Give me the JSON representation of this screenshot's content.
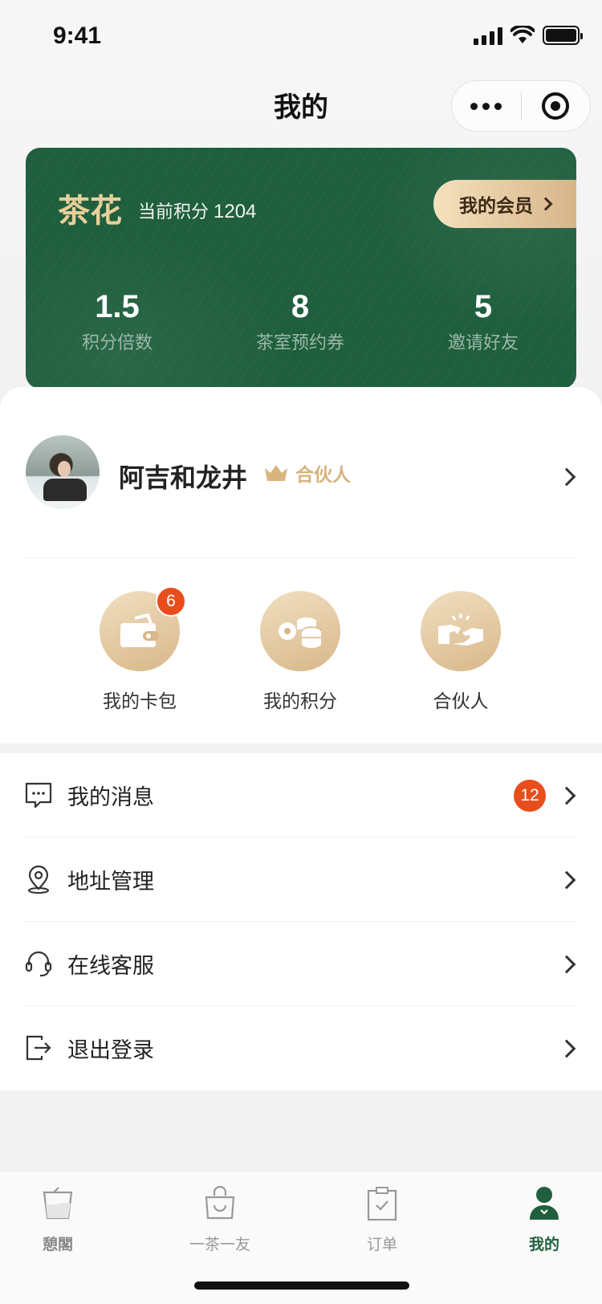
{
  "status_bar": {
    "time": "9:41"
  },
  "nav": {
    "title": "我的"
  },
  "member_card": {
    "level": "茶花",
    "points_label": "当前积分",
    "points_value": "1204",
    "member_button": "我的会员",
    "stats": [
      {
        "value": "1.5",
        "label": "积分倍数"
      },
      {
        "value": "8",
        "label": "茶室预约券"
      },
      {
        "value": "5",
        "label": "邀请好友"
      }
    ]
  },
  "profile": {
    "username": "阿吉和龙井",
    "badge": "合伙人"
  },
  "quick_actions": [
    {
      "label": "我的卡包",
      "icon": "wallet-icon",
      "badge": "6"
    },
    {
      "label": "我的积分",
      "icon": "coins-icon"
    },
    {
      "label": "合伙人",
      "icon": "handshake-icon"
    }
  ],
  "menu": [
    {
      "label": "我的消息",
      "icon": "message-icon",
      "badge": "12"
    },
    {
      "label": "地址管理",
      "icon": "location-icon"
    },
    {
      "label": "在线客服",
      "icon": "headset-icon"
    },
    {
      "label": "退出登录",
      "icon": "logout-icon"
    }
  ],
  "tabbar": [
    {
      "label": "憩閣",
      "icon": "teacup-icon"
    },
    {
      "label": "一茶一友",
      "icon": "shopping-bag-icon"
    },
    {
      "label": "订单",
      "icon": "clipboard-icon"
    },
    {
      "label": "我的",
      "icon": "user-icon",
      "active": true
    }
  ],
  "colors": {
    "card_green": "#1f5f3e",
    "gold": "#d6b37e",
    "badge_red": "#e84e1b",
    "active_tab": "#1f5f3e"
  }
}
